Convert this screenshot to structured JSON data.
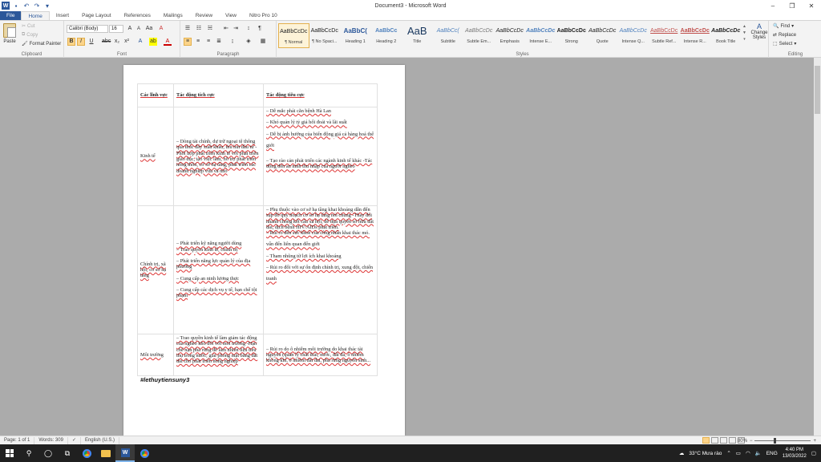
{
  "window": {
    "title": "Document3 - Microsoft Word"
  },
  "tabs": [
    "File",
    "Home",
    "Insert",
    "Page Layout",
    "References",
    "Mailings",
    "Review",
    "View",
    "Nitro Pro 10"
  ],
  "ribbon": {
    "clipboard": {
      "label": "Clipboard",
      "paste": "Paste",
      "cut": "Cut",
      "copy": "Copy",
      "format_painter": "Format Painter"
    },
    "font": {
      "label": "Font",
      "family": "Calibri (Body)",
      "size": "16"
    },
    "paragraph": {
      "label": "Paragraph"
    },
    "styles": {
      "label": "Styles",
      "items": [
        {
          "sample": "AaBbCcDc",
          "name": "¶ Normal"
        },
        {
          "sample": "AaBbCcDc",
          "name": "¶ No Spaci..."
        },
        {
          "sample": "AaBbC(",
          "name": "Heading 1"
        },
        {
          "sample": "AaBbCc",
          "name": "Heading 2"
        },
        {
          "sample": "AaB",
          "name": "Title"
        },
        {
          "sample": "AaBbCc(",
          "name": "Subtitle"
        },
        {
          "sample": "AaBbCcDc",
          "name": "Subtle Em..."
        },
        {
          "sample": "AaBbCcDc",
          "name": "Emphasis"
        },
        {
          "sample": "AaBbCcDc",
          "name": "Intense E..."
        },
        {
          "sample": "AaBbCcDc",
          "name": "Strong"
        },
        {
          "sample": "AaBbCcDc",
          "name": "Quote"
        },
        {
          "sample": "AaBbCcDc",
          "name": "Intense Q..."
        },
        {
          "sample": "AaBbCcDc",
          "name": "Subtle Ref..."
        },
        {
          "sample": "AaBbCcDc",
          "name": "Intense R..."
        },
        {
          "sample": "AaBbCcDc",
          "name": "Book Title"
        }
      ],
      "change_styles": "Change Styles"
    },
    "editing": {
      "label": "Editing",
      "find": "Find",
      "replace": "Replace",
      "select": "Select"
    }
  },
  "document": {
    "table": {
      "headers": [
        "Các lĩnh vực",
        "Tác động tích cực",
        "Tác động tiêu cực"
      ],
      "rows": [
        {
          "field": "Kinh tế",
          "positive": [
            "– Dòng tài chính, dự trữ ngoại tệ thông qua thúc đẩy xuất khẩu, thu hút đầu tư -Phối hợp phát triển kinh tế với phát triển giáo dục, tạo việc làm, hỗ trợ phát triển nông thôn, cơ sở hạ tầng, phát triển các doanh nghiệp vừa và nhỏ"
          ],
          "negative": [
            "– Dễ mắc phải căn bệnh Hà Lan",
            "– Khó quản lý tỷ giá hối đoái và lãi suất",
            "– Dễ bị ảnh hưởng của biến động giá cả hàng hoá thế",
            "giới",
            "– Tạo rào cản phát triển các ngành kinh tế khác -Tác động đến an ninh thu nhập của người nghèo"
          ]
        },
        {
          "field": "Chính trị, xã hội, cơ sở hạ tầng",
          "positive": [
            "– Phát triển kỹ năng người dùng\n– Trao quyền kinh tế, chính trị",
            "– Phát triển năng lực quản lý của địa phương",
            "– Cung cấp an ninh lương thực",
            "– Cung cấp các dịch vụ y tế, hạn chế tội phạm"
          ],
          "negative": [
            "– Phụ thuộc vào cơ sở hạ tầng khai khoáng dẫn đến sụp đổ quy hoạch cơ sở hạ tầng nói chung -Thay đổi nhanh chóng kết cấu xã hội, dễ dựa quyền sở hữu đất đai, dịch bệnh HIV/AIDs phát triển.\n– Rủi ro đến sức khoẻ của công nhân khai thác mỏ.",
            "vấn đến liên quan đến giới",
            "– Tham nhũng từ lợi ích khai khoáng",
            "– Rủi ro đối với sự ổn định chính trị, xung đột, chiến",
            "tranh"
          ]
        },
        {
          "field": "Môi trường",
          "positive": [
            "– Trao quyền kinh tế làm giảm tác động của nghèo khó đối với môi trường -Hạn chế nạn phá rừng để làm nhiên liệu tiêu thụ trong nước, giải phóng mặt bằng đất đai cho phát triển nông nghiệp"
          ],
          "negative": [
            "– Rủi ro do ô nhiễm môi trường do khai thác tài nguyên (quản lý chất thải, nước, đất đá, ô nhiễm không khí, ô nhiễm đất đai, phá rừng nguyên sinh..."
          ]
        }
      ]
    },
    "hashtag": "#lethuytiensuny3"
  },
  "status": {
    "page": "Page: 1 of 1",
    "words": "Words: 309",
    "language": "English (U.S.)",
    "zoom": "80%"
  },
  "taskbar": {
    "weather": "33°C  Mưa rào",
    "lang": "ENG",
    "time": "4:40 PM",
    "date": "13/03/2022"
  }
}
